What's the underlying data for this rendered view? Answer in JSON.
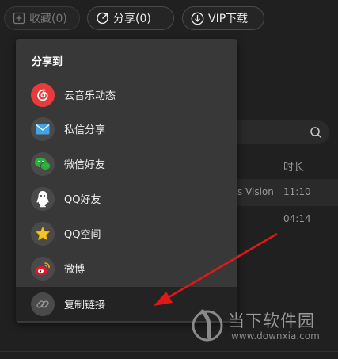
{
  "toolbar": {
    "favorite_label": "收藏(0)",
    "share_label": "分享(0)",
    "vip_label": "VIP下载"
  },
  "background": {
    "duration_header": "时长",
    "rows": [
      {
        "title_fragment": "s Vision",
        "duration": "11:10"
      },
      {
        "title_fragment": "",
        "duration": "04:14"
      }
    ]
  },
  "share_menu": {
    "title": "分享到",
    "items": [
      {
        "label": "云音乐动态",
        "icon": "netease-music-icon",
        "color": "#e83c3c"
      },
      {
        "label": "私信分享",
        "icon": "mail-icon",
        "color": "#4a4a4a"
      },
      {
        "label": "微信好友",
        "icon": "wechat-icon",
        "color": "#4a4a4a"
      },
      {
        "label": "QQ好友",
        "icon": "qq-icon",
        "color": "#4a4a4a"
      },
      {
        "label": "QQ空间",
        "icon": "qzone-star-icon",
        "color": "#4a4a4a"
      },
      {
        "label": "微博",
        "icon": "weibo-icon",
        "color": "#4a4a4a"
      },
      {
        "label": "复制链接",
        "icon": "link-icon",
        "color": "#4a4a4a"
      }
    ]
  },
  "watermark": {
    "name": "当下软件园",
    "url": "www.downxia.com"
  },
  "colors": {
    "background": "#202020",
    "menu_bg": "#383838",
    "arrow": "#e01818",
    "netease_red": "#e83c3c"
  }
}
